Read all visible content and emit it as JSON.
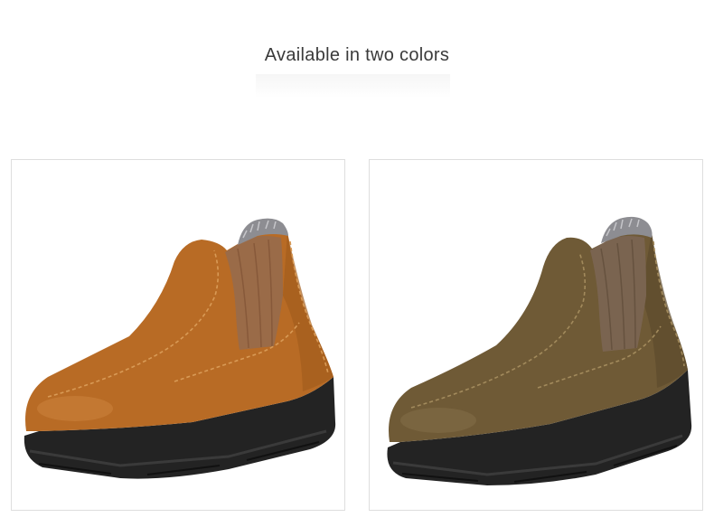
{
  "headline": "Available in two colors",
  "colors": {
    "left_upper": "#b76a24",
    "left_panel": "#9a6b48",
    "right_upper": "#6f5a36",
    "right_panel": "#7a6450",
    "sole": "#232323",
    "lining": "#8d8d92"
  }
}
